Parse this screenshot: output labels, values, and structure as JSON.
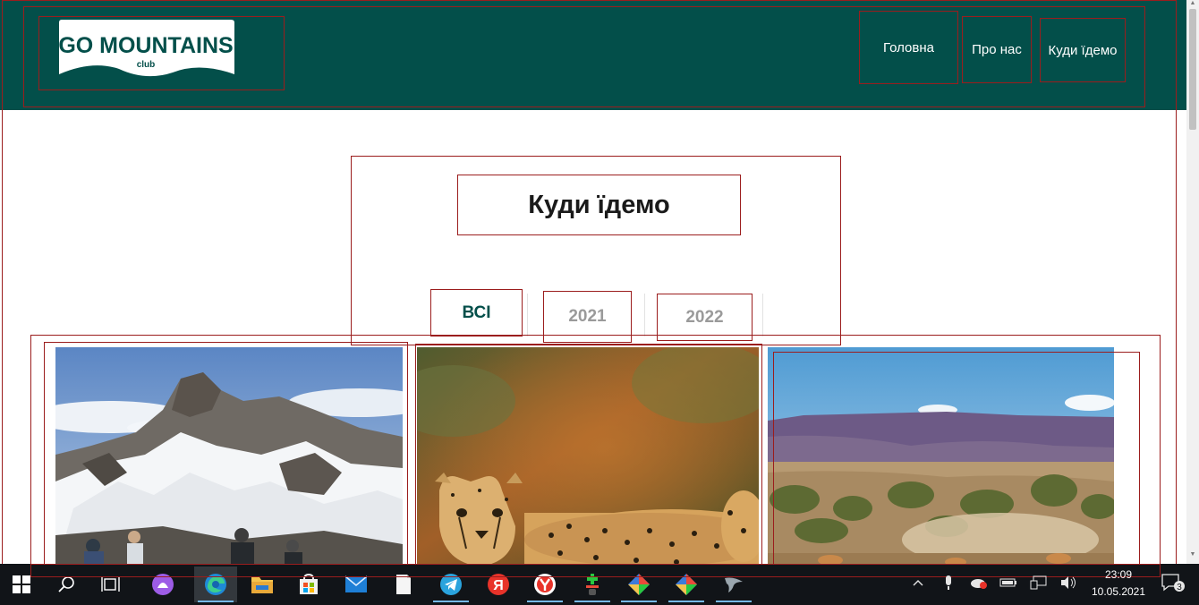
{
  "header": {
    "logo": {
      "line1": "GO MOUNTAINS",
      "line2": "club"
    },
    "nav": [
      {
        "label": "Головна"
      },
      {
        "label": "Про нас"
      },
      {
        "label": "Куди їдемо"
      }
    ]
  },
  "main": {
    "title": "Куди їдемо",
    "filters": [
      {
        "label": "ВСІ",
        "active": true
      },
      {
        "label": "2021",
        "active": false
      },
      {
        "label": "2022",
        "active": false
      }
    ],
    "gallery": [
      {
        "image": "snowy-mountain-photo"
      },
      {
        "image": "cheetah-photo"
      },
      {
        "image": "desert-savanna-photo"
      }
    ]
  },
  "taskbar": {
    "apps": [
      "windows-start",
      "search",
      "task-view",
      "alice-assistant",
      "edge",
      "file-explorer",
      "microsoft-store",
      "mail",
      "notepad",
      "telegram",
      "yandex",
      "yandex-browser",
      "app-green",
      "app-colorful-1",
      "app-colorful-2",
      "app-bird"
    ],
    "clock": {
      "time": "23:09",
      "date": "10.05.2021"
    },
    "notifications": "3"
  },
  "colors": {
    "header_bg": "#034f4a",
    "accent": "#034f4a",
    "debug_border": "#9b1d1d"
  }
}
